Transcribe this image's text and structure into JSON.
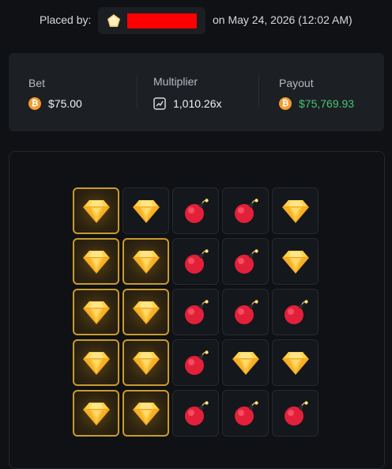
{
  "header": {
    "placed_by_label": "Placed by:",
    "date_text": "on May 24, 2026 (12:02 AM)"
  },
  "stats": {
    "bet_label": "Bet",
    "bet_value": "$75.00",
    "multiplier_label": "Multiplier",
    "multiplier_value": "1,010.26x",
    "payout_label": "Payout",
    "payout_value": "$75,769.93"
  },
  "icons": {
    "currency": "bitcoin-icon",
    "multiplier": "chart-icon",
    "rank": "diamond-rank-icon",
    "gem": "gem-icon",
    "mine": "bomb-icon"
  },
  "colors": {
    "background": "#0f1114",
    "card": "#1c1f23",
    "payout_green": "#46c773",
    "picked_border": "#c99a2e",
    "bitcoin_orange": "#f39b2b",
    "bomb_red": "#e3203a",
    "redacted": "#ff0000"
  },
  "board": {
    "rows": [
      [
        {
          "type": "gem",
          "picked": true
        },
        {
          "type": "gem",
          "picked": false
        },
        {
          "type": "mine",
          "picked": false
        },
        {
          "type": "mine",
          "picked": false
        },
        {
          "type": "gem",
          "picked": false
        }
      ],
      [
        {
          "type": "gem",
          "picked": true
        },
        {
          "type": "gem",
          "picked": true
        },
        {
          "type": "mine",
          "picked": false
        },
        {
          "type": "mine",
          "picked": false
        },
        {
          "type": "gem",
          "picked": false
        }
      ],
      [
        {
          "type": "gem",
          "picked": true
        },
        {
          "type": "gem",
          "picked": true
        },
        {
          "type": "mine",
          "picked": false
        },
        {
          "type": "mine",
          "picked": false
        },
        {
          "type": "mine",
          "picked": false
        }
      ],
      [
        {
          "type": "gem",
          "picked": true
        },
        {
          "type": "gem",
          "picked": true
        },
        {
          "type": "mine",
          "picked": false
        },
        {
          "type": "gem",
          "picked": false
        },
        {
          "type": "gem",
          "picked": false
        }
      ],
      [
        {
          "type": "gem",
          "picked": true
        },
        {
          "type": "gem",
          "picked": true
        },
        {
          "type": "mine",
          "picked": false
        },
        {
          "type": "mine",
          "picked": false
        },
        {
          "type": "mine",
          "picked": false
        }
      ]
    ]
  }
}
